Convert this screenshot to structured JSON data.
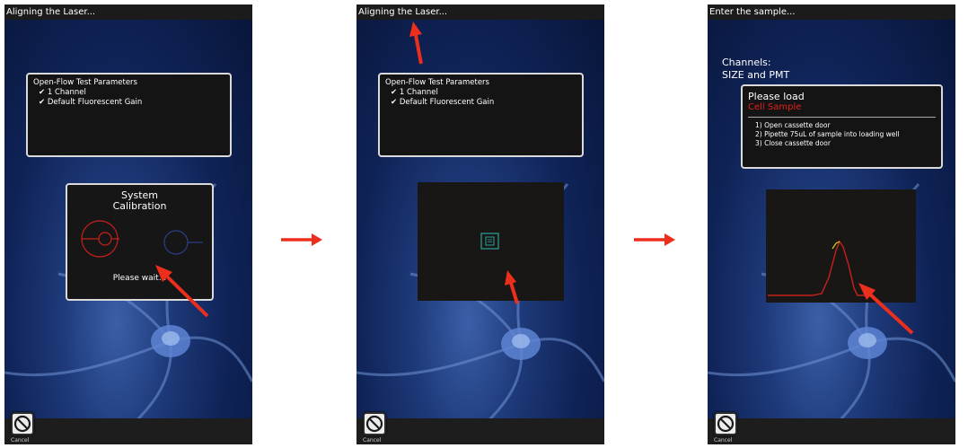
{
  "screens": [
    {
      "title": "Aligning the Laser...",
      "params": {
        "heading": "Open-Flow Test Parameters",
        "items": [
          "1 Channel",
          "Default Fluorescent Gain"
        ]
      },
      "calibration": {
        "title_line1": "System",
        "title_line2": "Calibration",
        "status": "Please wait..."
      },
      "cancel_label": "Cancel"
    },
    {
      "title": "Aligning the Laser...",
      "params": {
        "heading": "Open-Flow Test Parameters",
        "items": [
          "1 Channel",
          "Default Fluorescent Gain"
        ]
      },
      "cancel_label": "Cancel"
    },
    {
      "title": "Enter the sample...",
      "channels": {
        "line1": "Channels:",
        "line2": "SIZE and PMT"
      },
      "load": {
        "title": "Please load",
        "sample": "Cell Sample",
        "steps": [
          "1) Open cassette door",
          "2) Pipette 75uL of sample into loading well",
          "3) Close cassette door"
        ]
      },
      "cancel_label": "Cancel"
    }
  ],
  "icons": {
    "cancel": "cancel-icon",
    "check": "check-icon",
    "annotation_arrow": "red-arrow"
  },
  "colors": {
    "annotation_arrow": "#ec2e1c",
    "sample_text": "#e0211b",
    "target": "#2aa198",
    "curve": "#c8201b"
  }
}
